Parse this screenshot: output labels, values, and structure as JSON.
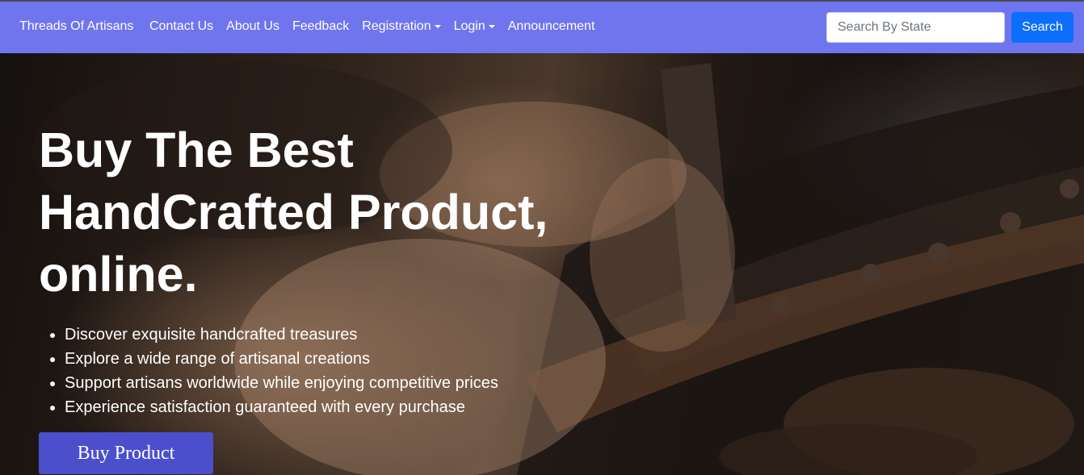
{
  "navbar": {
    "brand": "Threads Of Artisans",
    "links": [
      {
        "label": "Contact Us",
        "dropdown": false
      },
      {
        "label": "About Us",
        "dropdown": false
      },
      {
        "label": "Feedback",
        "dropdown": false
      },
      {
        "label": "Registration",
        "dropdown": true
      },
      {
        "label": "Login",
        "dropdown": true
      },
      {
        "label": "Announcement",
        "dropdown": false
      }
    ],
    "search_placeholder": "Search By State",
    "search_button": "Search",
    "color": "#6f75ef"
  },
  "hero": {
    "title": "Buy The Best HandCrafted Product, online.",
    "bullets": [
      "Discover exquisite handcrafted treasures",
      "Explore a wide range of artisanal creations",
      "Support artisans worldwide while enjoying competitive prices",
      "Experience satisfaction guaranteed with every purchase"
    ],
    "cta": "Buy Product",
    "cta_color": "#4b4fcc"
  }
}
